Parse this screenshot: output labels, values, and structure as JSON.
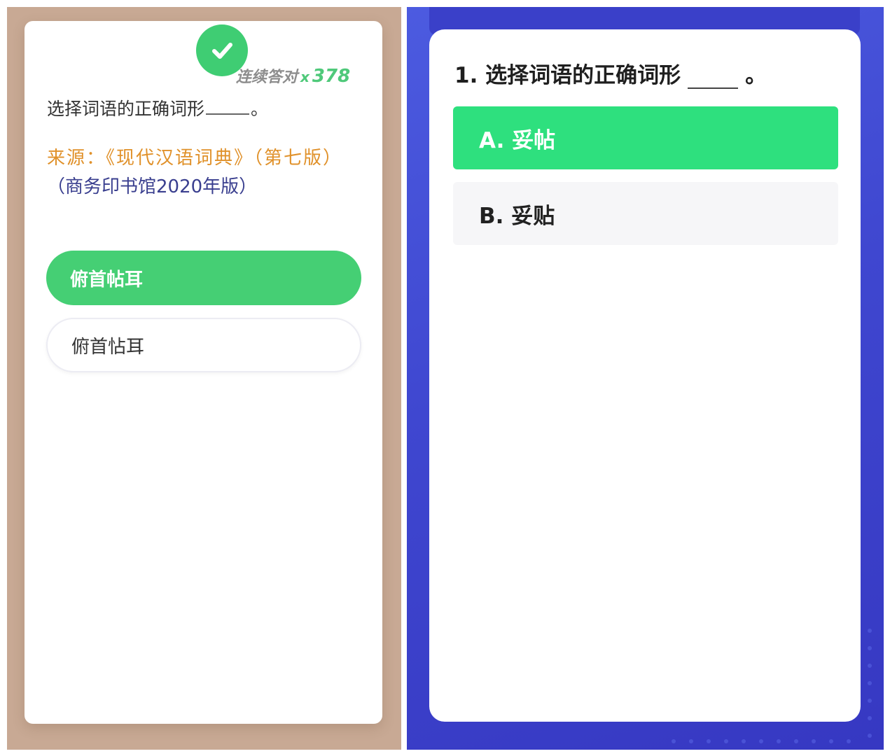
{
  "left": {
    "streak": {
      "label": "连续答对",
      "multiplier": "x",
      "count": "378"
    },
    "question": {
      "prefix": "选择词语的正确词形",
      "suffix": "。"
    },
    "source": {
      "label": "来源：",
      "book": "《现代汉语词典》（第七版）",
      "publisher": "（商务印书馆2020年版）"
    },
    "options": [
      {
        "label": "俯首帖耳",
        "state": "selected"
      },
      {
        "label": "俯首怗耳",
        "state": "normal"
      }
    ]
  },
  "right": {
    "question": {
      "prefix": "1. 选择词语的正确词形",
      "suffix": "。"
    },
    "options": [
      {
        "label": "A. 妥帖",
        "state": "selected"
      },
      {
        "label": "B. 妥贴",
        "state": "normal"
      }
    ]
  },
  "colors": {
    "left_bg": "#c8a994",
    "left_green": "#45cf74",
    "source_orange": "#e0912a",
    "source_blue": "#3a3f8f",
    "right_bg": "#4047d0",
    "right_green": "#2ee07e"
  },
  "icons": {
    "correct": "check-icon"
  }
}
